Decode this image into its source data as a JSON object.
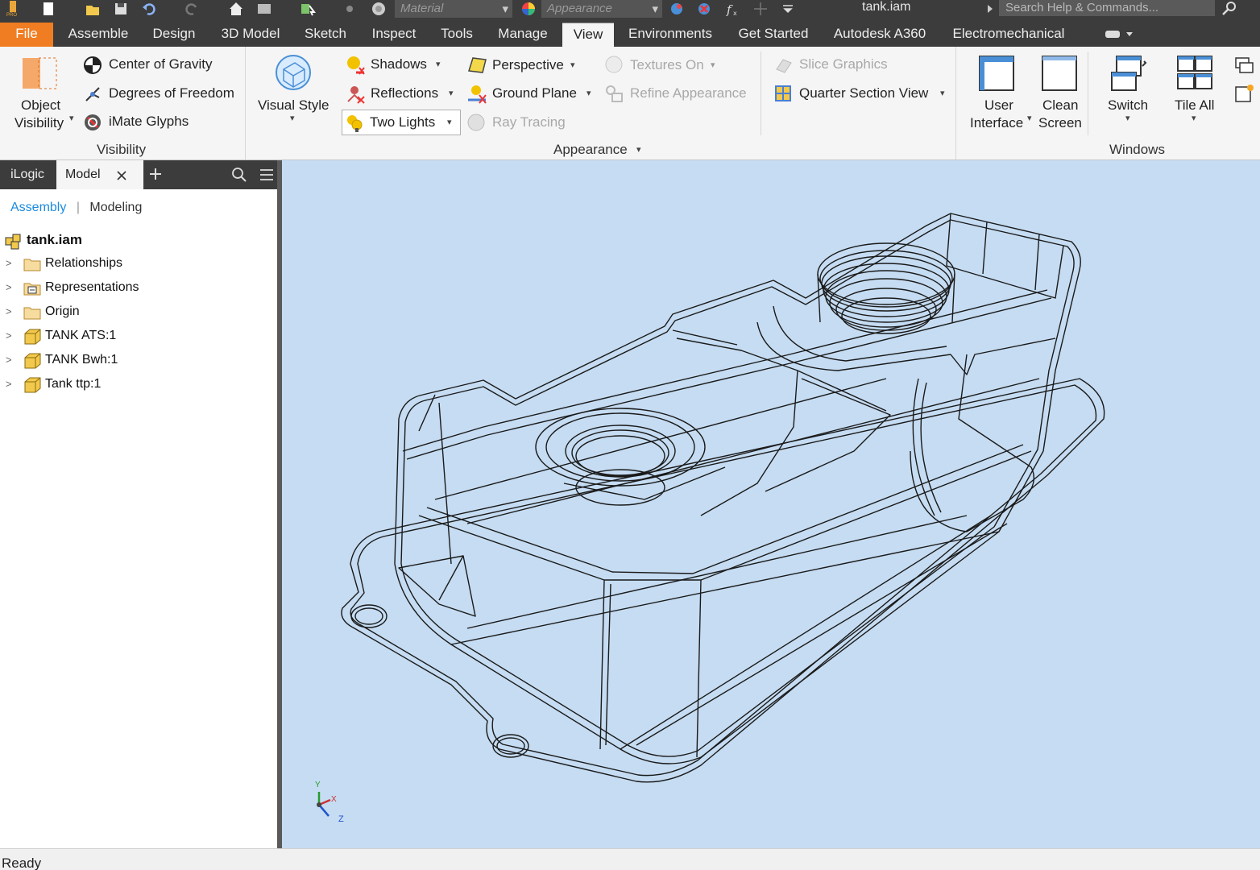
{
  "window": {
    "title": "tank.iam",
    "search_placeholder": "Search Help & Commands..."
  },
  "quick_access": {
    "material_placeholder": "Material",
    "appearance_placeholder": "Appearance"
  },
  "menu_tabs": [
    "File",
    "Assemble",
    "Design",
    "3D Model",
    "Sketch",
    "Inspect",
    "Tools",
    "Manage",
    "View",
    "Environments",
    "Get Started",
    "Autodesk A360",
    "Electromechanical"
  ],
  "active_tab": "View",
  "ribbon": {
    "visibility": {
      "label": "Visibility",
      "object_visibility": [
        "Object",
        "Visibility"
      ],
      "center_of_gravity": "Center of Gravity",
      "degrees_of_freedom": "Degrees of Freedom",
      "imate_glyphs": "iMate Glyphs"
    },
    "appearance": {
      "label": "Appearance",
      "visual_style": "Visual Style",
      "shadows": "Shadows",
      "reflections": "Reflections",
      "lighting": "Two Lights",
      "perspective": "Perspective",
      "ground_plane": "Ground Plane",
      "ray_tracing": "Ray Tracing",
      "textures_on": "Textures On",
      "refine_appearance": "Refine Appearance",
      "slice_graphics": "Slice Graphics",
      "quarter_section_view": "Quarter Section View"
    },
    "windows": {
      "label": "Windows",
      "user_interface": [
        "User",
        "Interface"
      ],
      "clean_screen": [
        "Clean",
        "Screen"
      ],
      "switch": "Switch",
      "tile_all": "Tile All"
    }
  },
  "browser": {
    "tabs": [
      "iLogic",
      "Model"
    ],
    "subtabs": [
      "Assembly",
      "Modeling"
    ],
    "root": "tank.iam",
    "items": [
      {
        "label": "Relationships",
        "icon": "folder-icon"
      },
      {
        "label": "Representations",
        "icon": "representations-icon"
      },
      {
        "label": "Origin",
        "icon": "folder-icon"
      },
      {
        "label": "TANK ATS:1",
        "icon": "part-icon"
      },
      {
        "label": "TANK Bwh:1",
        "icon": "part-icon"
      },
      {
        "label": "Tank ttp:1",
        "icon": "part-icon"
      }
    ]
  },
  "viewport": {
    "triad_labels": {
      "y": "Y",
      "x": "X",
      "z": "Z"
    }
  },
  "status": {
    "text": "Ready"
  },
  "colors": {
    "file_tab": "#f07d22",
    "viewport_bg": "#c5dcf2",
    "dark_chrome": "#3c3c3c",
    "link_blue": "#1a8be0"
  }
}
